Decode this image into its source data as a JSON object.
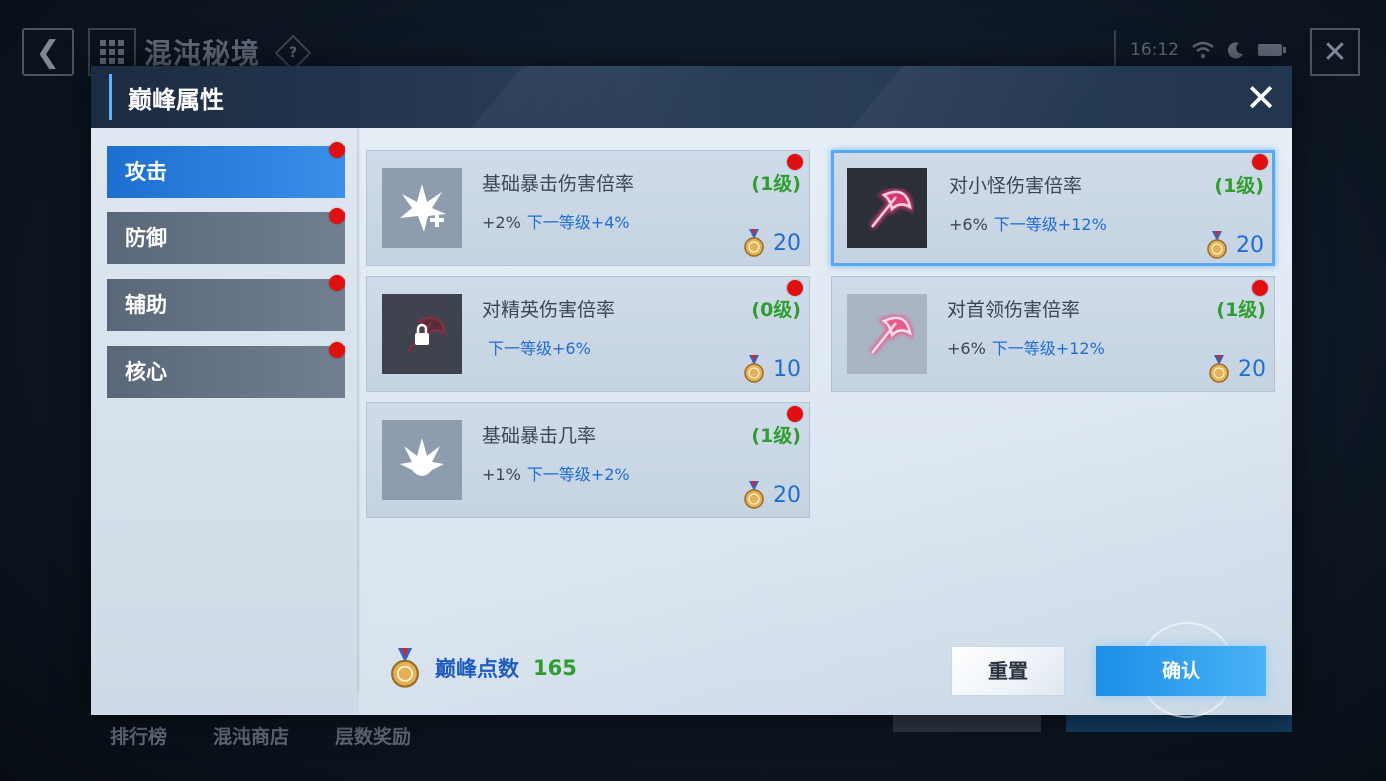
{
  "hud": {
    "back_icon": "chevron-left-icon",
    "menu_icon": "grid-icon",
    "title": "混沌秘境",
    "help_label": "?",
    "time": "16:12",
    "close_icon": "close-icon",
    "bottom_links": [
      "排行榜",
      "混沌商店",
      "层数奖励"
    ]
  },
  "dialog": {
    "title": "巅峰属性",
    "close_label": "✕",
    "tabs": [
      {
        "label": "攻击",
        "active": true,
        "badge": true
      },
      {
        "label": "防御",
        "active": false,
        "badge": true
      },
      {
        "label": "辅助",
        "active": false,
        "badge": true
      },
      {
        "label": "核心",
        "active": false,
        "badge": true
      }
    ],
    "cards": [
      {
        "name": "基础暴击伤害倍率",
        "level": "(1级)",
        "current": "+2%",
        "next": "下一等级+4%",
        "cost": "20",
        "icon": "crit-damage-icon",
        "locked": false,
        "selected": false
      },
      {
        "name": "对小怪伤害倍率",
        "level": "(1级)",
        "current": "+6%",
        "next": "下一等级+12%",
        "cost": "20",
        "icon": "axe-icon",
        "locked": false,
        "selected": true
      },
      {
        "name": "对精英伤害倍率",
        "level": "(0级)",
        "current": "",
        "next": "下一等级+6%",
        "cost": "10",
        "icon": "axe-locked-icon",
        "locked": true,
        "selected": false
      },
      {
        "name": "对首领伤害倍率",
        "level": "(1级)",
        "current": "+6%",
        "next": "下一等级+12%",
        "cost": "20",
        "icon": "axe-icon",
        "locked": false,
        "selected": false
      },
      {
        "name": "基础暴击几率",
        "level": "(1级)",
        "current": "+1%",
        "next": "下一等级+2%",
        "cost": "20",
        "icon": "crit-chance-icon",
        "locked": false,
        "selected": false
      }
    ],
    "points_label": "巅峰点数",
    "points_value": "165",
    "reset_label": "重置",
    "confirm_label": "确认"
  },
  "colors": {
    "accent_blue": "#1f6ed1",
    "level_green": "#2f9e2f",
    "badge_red": "#e01010",
    "active_tab": "#2a80e0"
  }
}
